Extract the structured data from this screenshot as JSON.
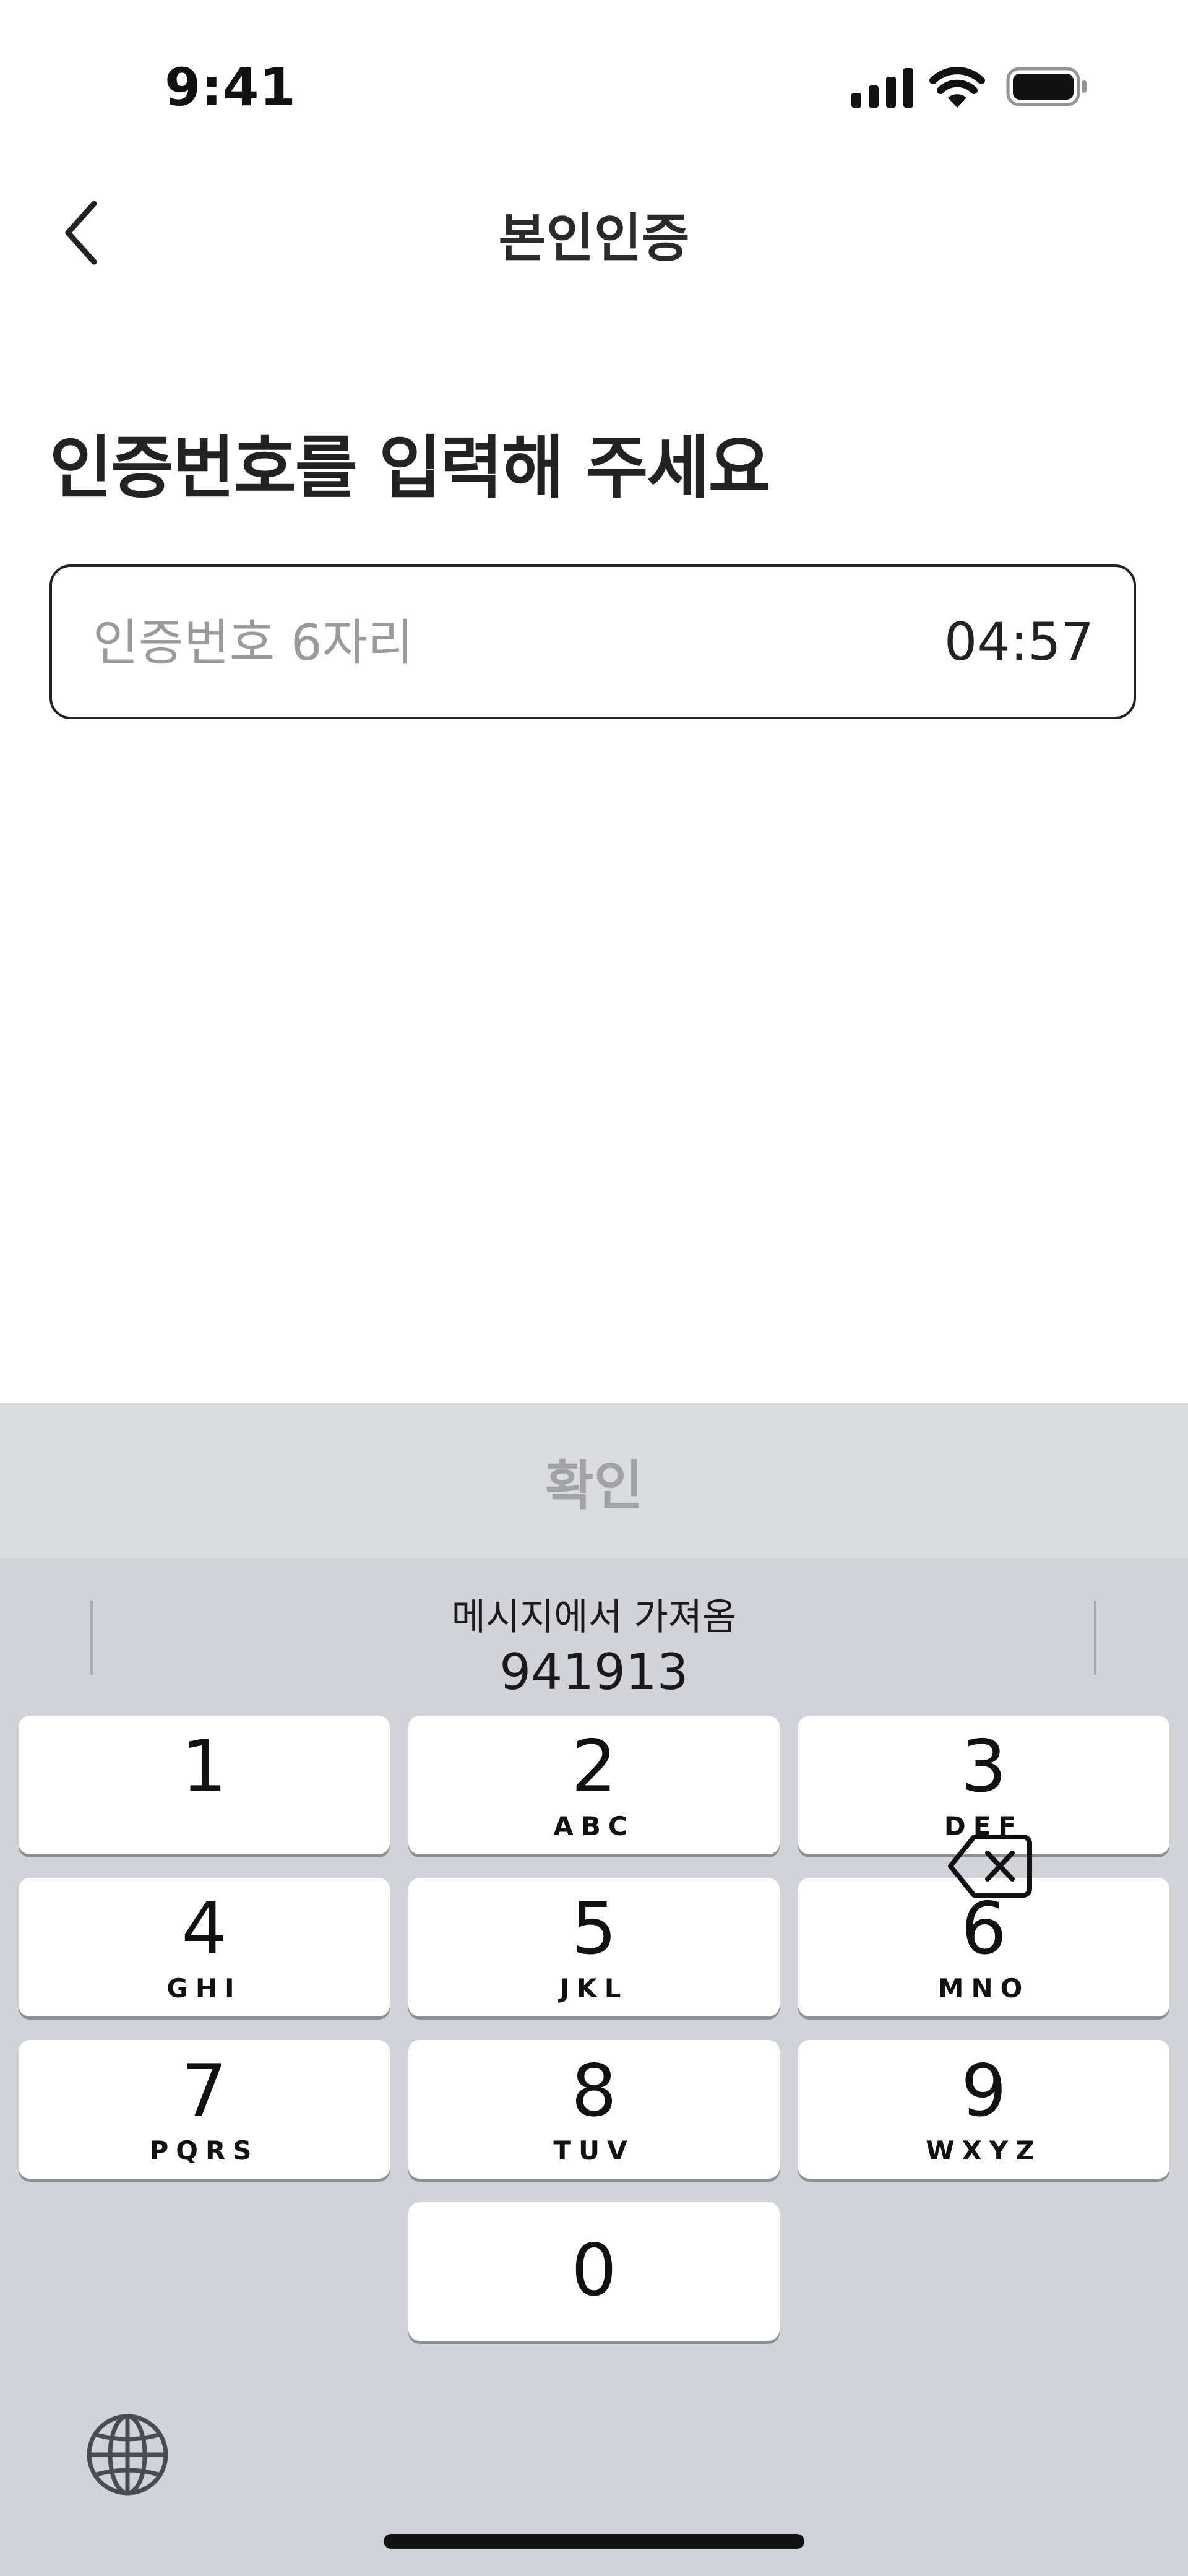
{
  "status_bar": {
    "time": "9:41"
  },
  "nav": {
    "title": "본인인증"
  },
  "headline": "인증번호를 입력해 주세요",
  "code_field": {
    "placeholder": "인증번호 6자리",
    "value": "",
    "timer": "04:57"
  },
  "confirm_button": {
    "label": "확인"
  },
  "keyboard": {
    "suggestion_label": "메시지에서 가져옴",
    "suggestion_code": "941913",
    "keys": [
      {
        "num": "1",
        "letters": ""
      },
      {
        "num": "2",
        "letters": "ABC"
      },
      {
        "num": "3",
        "letters": "DEF"
      },
      {
        "num": "4",
        "letters": "GHI"
      },
      {
        "num": "5",
        "letters": "JKL"
      },
      {
        "num": "6",
        "letters": "MNO"
      },
      {
        "num": "7",
        "letters": "PQRS"
      },
      {
        "num": "8",
        "letters": "TUV"
      },
      {
        "num": "9",
        "letters": "WXYZ"
      },
      {
        "num": "0",
        "letters": ""
      }
    ]
  },
  "icons": {
    "back": "chevron-left-icon",
    "signal": "cellular-signal-icon",
    "wifi": "wifi-icon",
    "battery": "battery-icon",
    "delete": "backspace-icon",
    "globe": "globe-icon"
  },
  "colors": {
    "confirm_disabled_bg": "#dbdce0",
    "confirm_disabled_text": "#a2a3a8",
    "keyboard_bg": "#d1d3d9",
    "key_bg": "#ffffff"
  }
}
